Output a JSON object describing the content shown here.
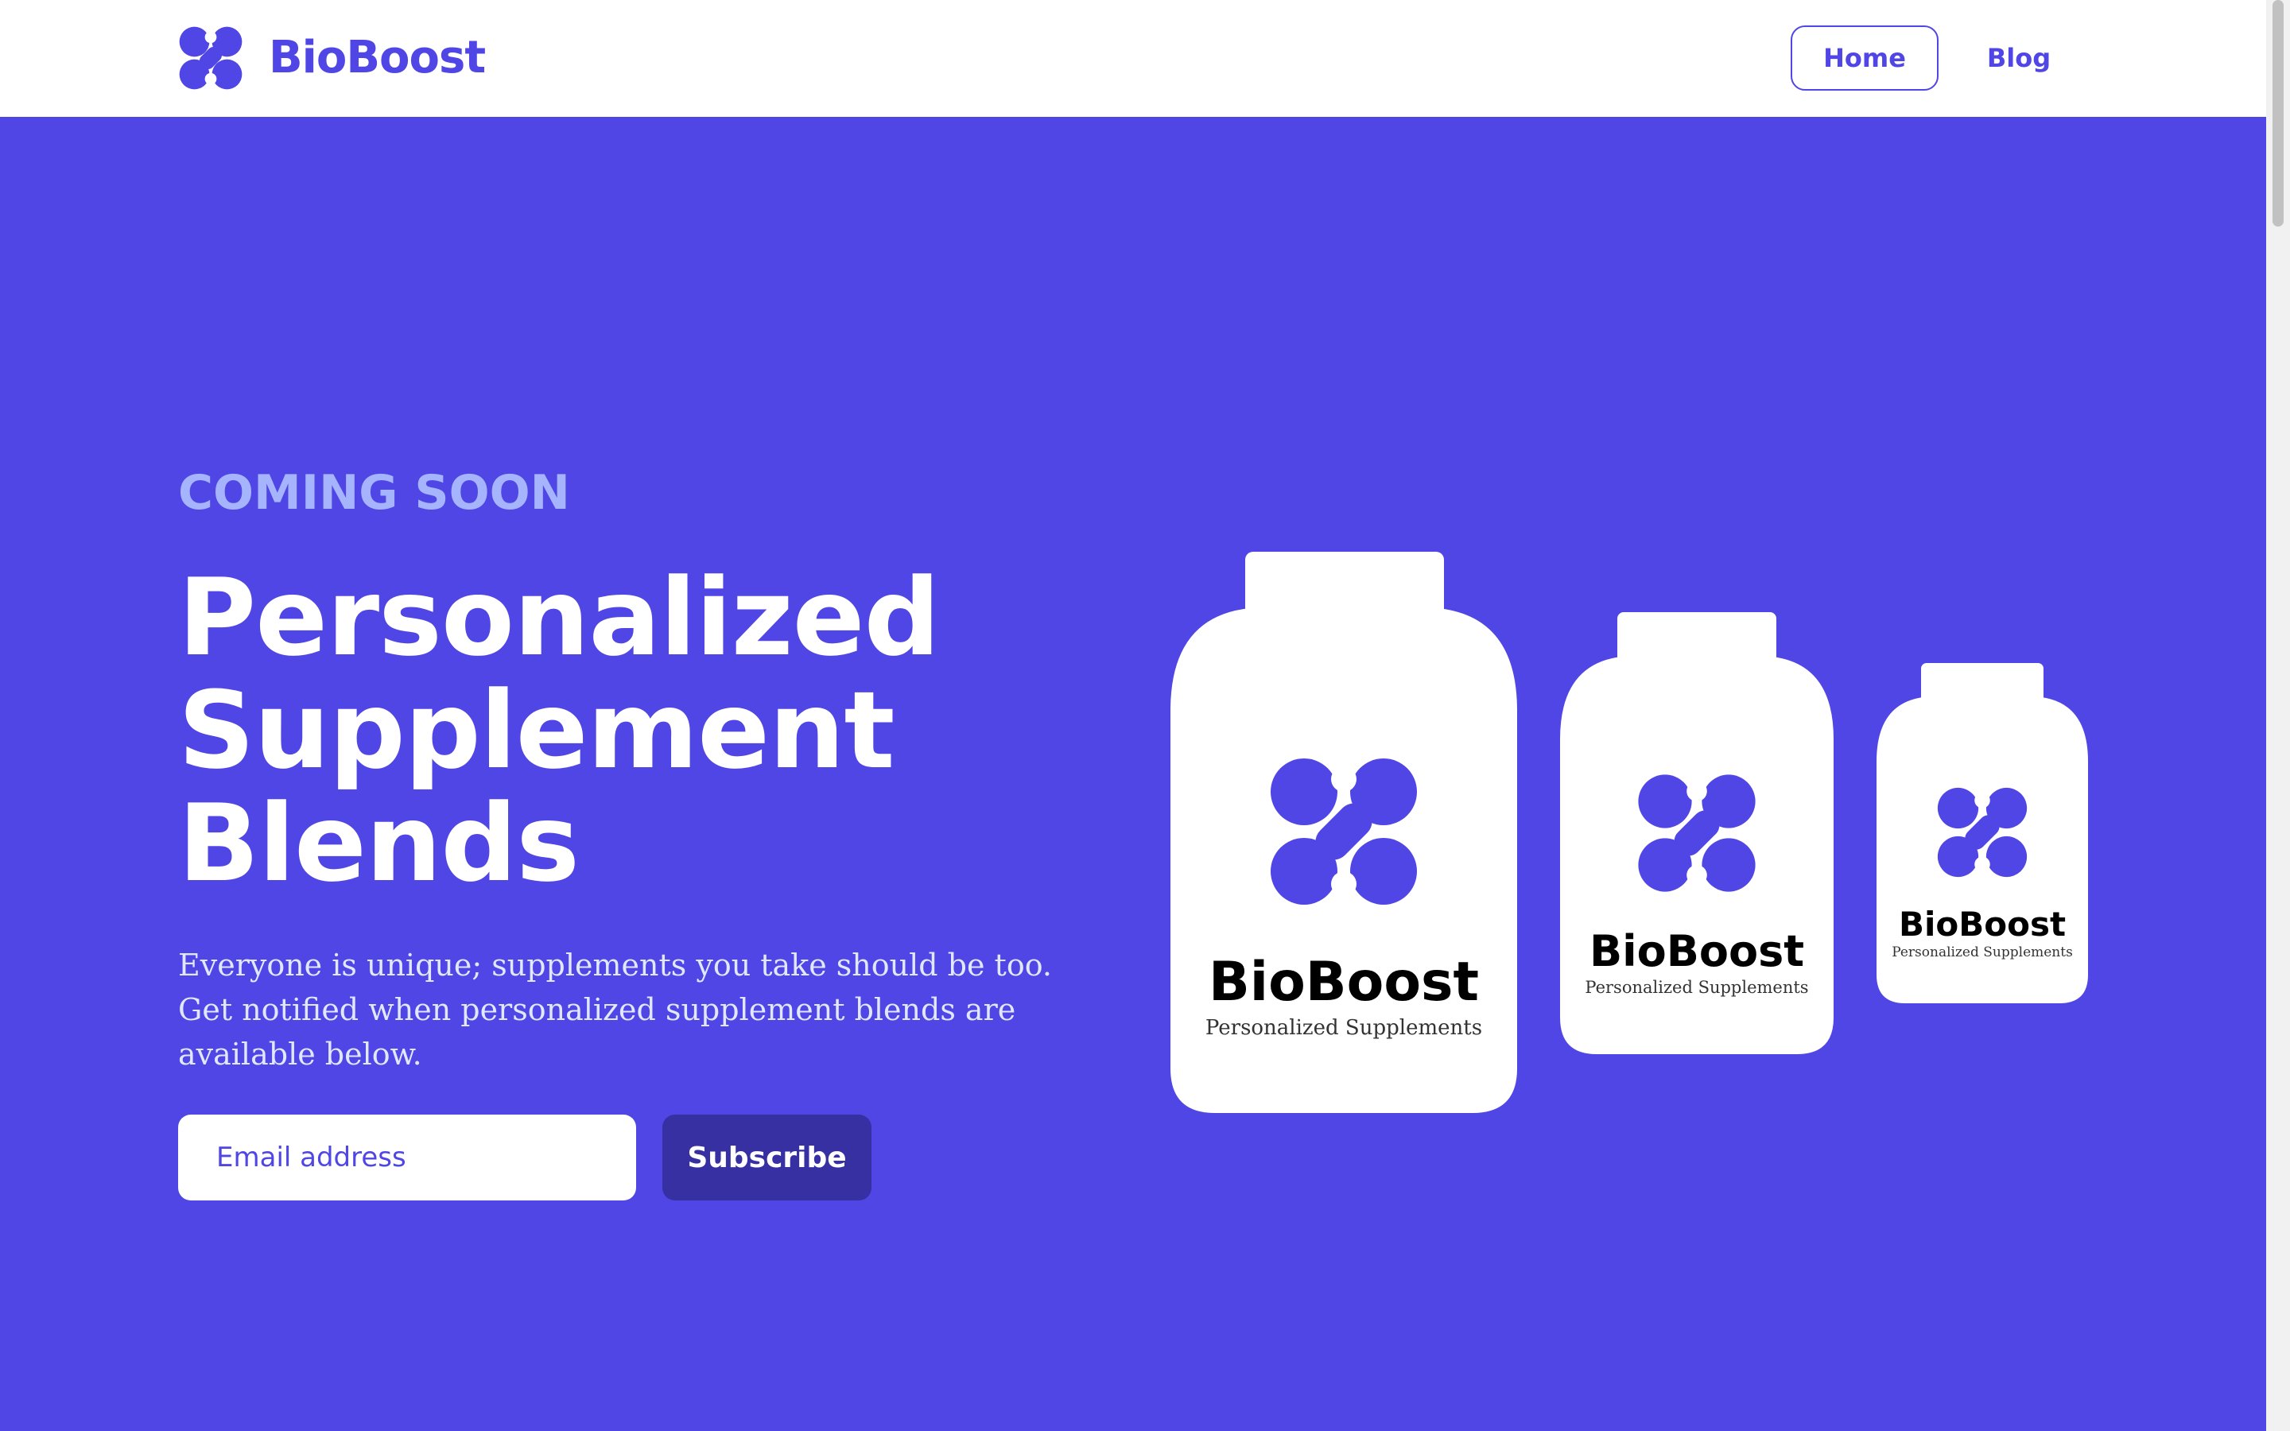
{
  "header": {
    "brand_name": "BioBoost",
    "nav": {
      "home": "Home",
      "blog": "Blog"
    }
  },
  "hero": {
    "eyebrow": "COMING SOON",
    "headline_lines": [
      "Personalized",
      "Supplement",
      "Blends"
    ],
    "description": "Everyone is unique; supplements you take should be too. Get notified when personalized supplement blends are available below.",
    "email_placeholder": "Email address",
    "subscribe_label": "Subscribe"
  },
  "bottles": {
    "brand": "BioBoost",
    "tagline": "Personalized Supplements"
  },
  "colors": {
    "primary": "#4f46e5",
    "button_dark": "#3730a3",
    "eyebrow": "#a5b4fc",
    "white": "#ffffff"
  },
  "icons": {
    "logo": "bioboost-logo-icon"
  }
}
